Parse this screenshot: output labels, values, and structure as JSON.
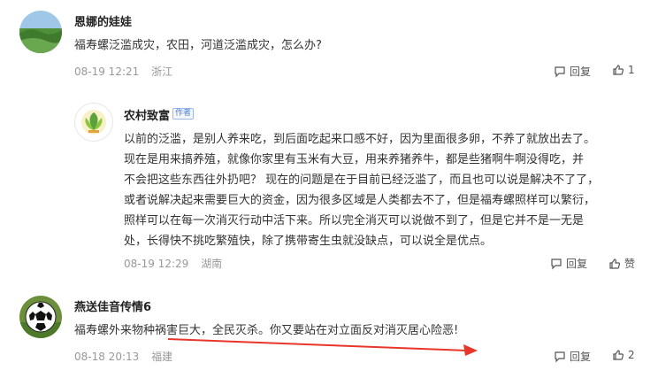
{
  "comments": [
    {
      "username": "恩娜的娃娃",
      "text": "福寿螺泛滥成灾，农田，河道泛滥成灾，怎么办?",
      "date": "08-19 12:21",
      "location": "浙江",
      "reply_label": "回复",
      "like_count": "1"
    },
    {
      "username": "农村致富",
      "badge": "作者",
      "lines": [
        "以前的泛滥，是别人养来吃，到后面吃起来口感不好，因为里面很多卵，不养了就放出去了。",
        "现在是用来搞养殖，就像你家里有玉米有大豆，用来养猪养牛，都是些猪啊牛啊没得吃，并",
        "不会把这些东西往外扔吧？ 现在的问题是在于目前已经泛滥了，而且也可以说是解决不了了，",
        "或者说解决起来需要巨大的资金，因为很多区域是人类都去不了，但是福寿螺照样可以繁衍，",
        "照样可以在每一次消灭行动中活下来。所以完全消灭可以说做不到了，但是它并不是一无是",
        "处，长得快不挑吃繁殖快，除了携带寄生虫就没缺点，可以说全是优点。"
      ],
      "date": "08-19 12:29",
      "location": "湖南",
      "reply_label": "回复",
      "like_label": "赞"
    },
    {
      "username": "燕送佳音传情6",
      "text": "福寿螺外来物种祸害巨大，全民灭杀。你又要站在对立面反对消灭居心险恶!",
      "date": "08-18 20:13",
      "location": "福建",
      "reply_label": "回复",
      "like_count": "2"
    }
  ],
  "colors": {
    "annotation_arrow": "#e8362b",
    "meta_text": "#999999"
  }
}
